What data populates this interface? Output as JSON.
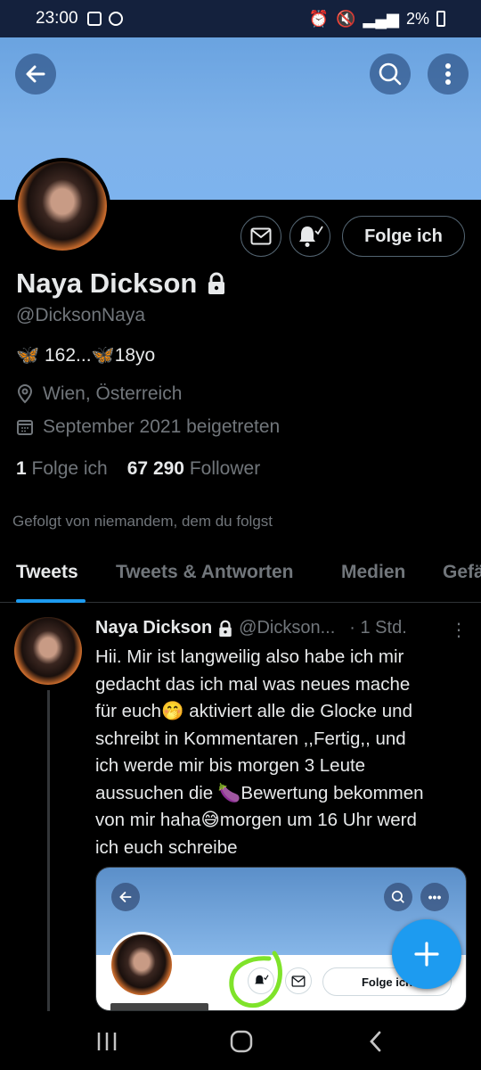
{
  "status_bar": {
    "time": "23:00",
    "battery": "2%"
  },
  "profile": {
    "name": "Naya Dickson",
    "handle": "@DicksonNaya",
    "bio_emoji_1": "🦋",
    "bio_text_1": " 162...",
    "bio_emoji_2": "🦋",
    "bio_text_2": "18yo",
    "location": "Wien, Österreich",
    "joined": "September 2021 beigetreten",
    "following_count": "1",
    "following_label": "Folge ich",
    "followers_count": "67 290",
    "followers_label": "Follower",
    "followed_by": "Gefolgt von niemandem, dem du folgst",
    "follow_button": "Folge ich"
  },
  "tabs": [
    {
      "label": "Tweets",
      "active": true
    },
    {
      "label": "Tweets & Antworten",
      "active": false
    },
    {
      "label": "Medien",
      "active": false
    },
    {
      "label": "Gefä",
      "active": false
    }
  ],
  "tweet": {
    "name": "Naya Dickson",
    "handle": "@Dickson...",
    "time": "· 1 Std.",
    "text_lines": [
      "Hii. Mir ist langweilig also habe ich mir",
      "gedacht das ich mal was neues mache",
      "für euch🤭 aktiviert alle die Glocke und",
      "schreibt in Kommentaren ,,Fertig,,  und",
      "ich werde mir bis morgen 3 Leute",
      "aussuchen die 🍆Bewertung bekommen",
      "von mir haha😅morgen um 16 Uhr werd",
      "ich euch schreibe"
    ],
    "embed_follow_label": "Folge ich"
  },
  "colors": {
    "accent": "#1d9bf0",
    "banner": "#7eb2ea",
    "highlight": "#7fe32a"
  },
  "icons": [
    "back-arrow-icon",
    "search-icon",
    "more-icon",
    "mail-icon",
    "bell-icon",
    "lock-icon",
    "location-icon",
    "calendar-icon",
    "plus-icon"
  ]
}
